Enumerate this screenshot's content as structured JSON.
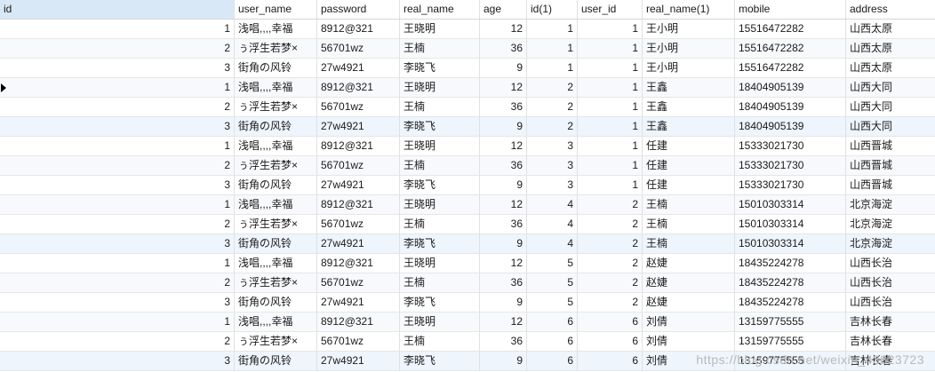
{
  "columns": [
    "id",
    "user_name",
    "password",
    "real_name",
    "age",
    "id(1)",
    "user_id",
    "real_name(1)",
    "mobile",
    "address"
  ],
  "rows": [
    [
      "1",
      "浅唱,,,,幸福",
      "8912@321",
      "王晓明",
      "12",
      "1",
      "1",
      "王小明",
      "15516472282",
      "山西太原"
    ],
    [
      "2",
      "ぅ浮生若梦×",
      "56701wz",
      "王楠",
      "36",
      "1",
      "1",
      "王小明",
      "15516472282",
      "山西太原"
    ],
    [
      "3",
      "街角の风铃",
      "27w4921",
      "李晓飞",
      "9",
      "1",
      "1",
      "王小明",
      "15516472282",
      "山西太原"
    ],
    [
      "1",
      "浅唱,,,,幸福",
      "8912@321",
      "王晓明",
      "12",
      "2",
      "1",
      "王鑫",
      "18404905139",
      "山西大同"
    ],
    [
      "2",
      "ぅ浮生若梦×",
      "56701wz",
      "王楠",
      "36",
      "2",
      "1",
      "王鑫",
      "18404905139",
      "山西大同"
    ],
    [
      "3",
      "街角の风铃",
      "27w4921",
      "李晓飞",
      "9",
      "2",
      "1",
      "王鑫",
      "18404905139",
      "山西大同"
    ],
    [
      "1",
      "浅唱,,,,幸福",
      "8912@321",
      "王晓明",
      "12",
      "3",
      "1",
      "任建",
      "15333021730",
      "山西晋城"
    ],
    [
      "2",
      "ぅ浮生若梦×",
      "56701wz",
      "王楠",
      "36",
      "3",
      "1",
      "任建",
      "15333021730",
      "山西晋城"
    ],
    [
      "3",
      "街角の风铃",
      "27w4921",
      "李晓飞",
      "9",
      "3",
      "1",
      "任建",
      "15333021730",
      "山西晋城"
    ],
    [
      "1",
      "浅唱,,,,幸福",
      "8912@321",
      "王晓明",
      "12",
      "4",
      "2",
      "王楠",
      "15010303314",
      "北京海淀"
    ],
    [
      "2",
      "ぅ浮生若梦×",
      "56701wz",
      "王楠",
      "36",
      "4",
      "2",
      "王楠",
      "15010303314",
      "北京海淀"
    ],
    [
      "3",
      "街角の风铃",
      "27w4921",
      "李晓飞",
      "9",
      "4",
      "2",
      "王楠",
      "15010303314",
      "北京海淀"
    ],
    [
      "1",
      "浅唱,,,,幸福",
      "8912@321",
      "王晓明",
      "12",
      "5",
      "2",
      "赵婕",
      "18435224278",
      "山西长治"
    ],
    [
      "2",
      "ぅ浮生若梦×",
      "56701wz",
      "王楠",
      "36",
      "5",
      "2",
      "赵婕",
      "18435224278",
      "山西长治"
    ],
    [
      "3",
      "街角の风铃",
      "27w4921",
      "李晓飞",
      "9",
      "5",
      "2",
      "赵婕",
      "18435224278",
      "山西长治"
    ],
    [
      "1",
      "浅唱,,,,幸福",
      "8912@321",
      "王晓明",
      "12",
      "6",
      "6",
      "刘倩",
      "13159775555",
      "吉林长春"
    ],
    [
      "2",
      "ぅ浮生若梦×",
      "56701wz",
      "王楠",
      "36",
      "6",
      "6",
      "刘倩",
      "13159775555",
      "吉林长春"
    ],
    [
      "3",
      "街角の风铃",
      "27w4921",
      "李晓飞",
      "9",
      "6",
      "6",
      "刘倩",
      "13159775555",
      "吉林长春"
    ]
  ],
  "current_row": 3,
  "highlight_rows": [
    5,
    11,
    17
  ],
  "watermark": "https://blog.csdn.net/weixin_43823723",
  "colors": {
    "header_selected": "#d9e8f7",
    "row_alt": "#f7f9fc",
    "row_highlight": "#eef5fd",
    "grid_line": "#e1e1e1"
  }
}
